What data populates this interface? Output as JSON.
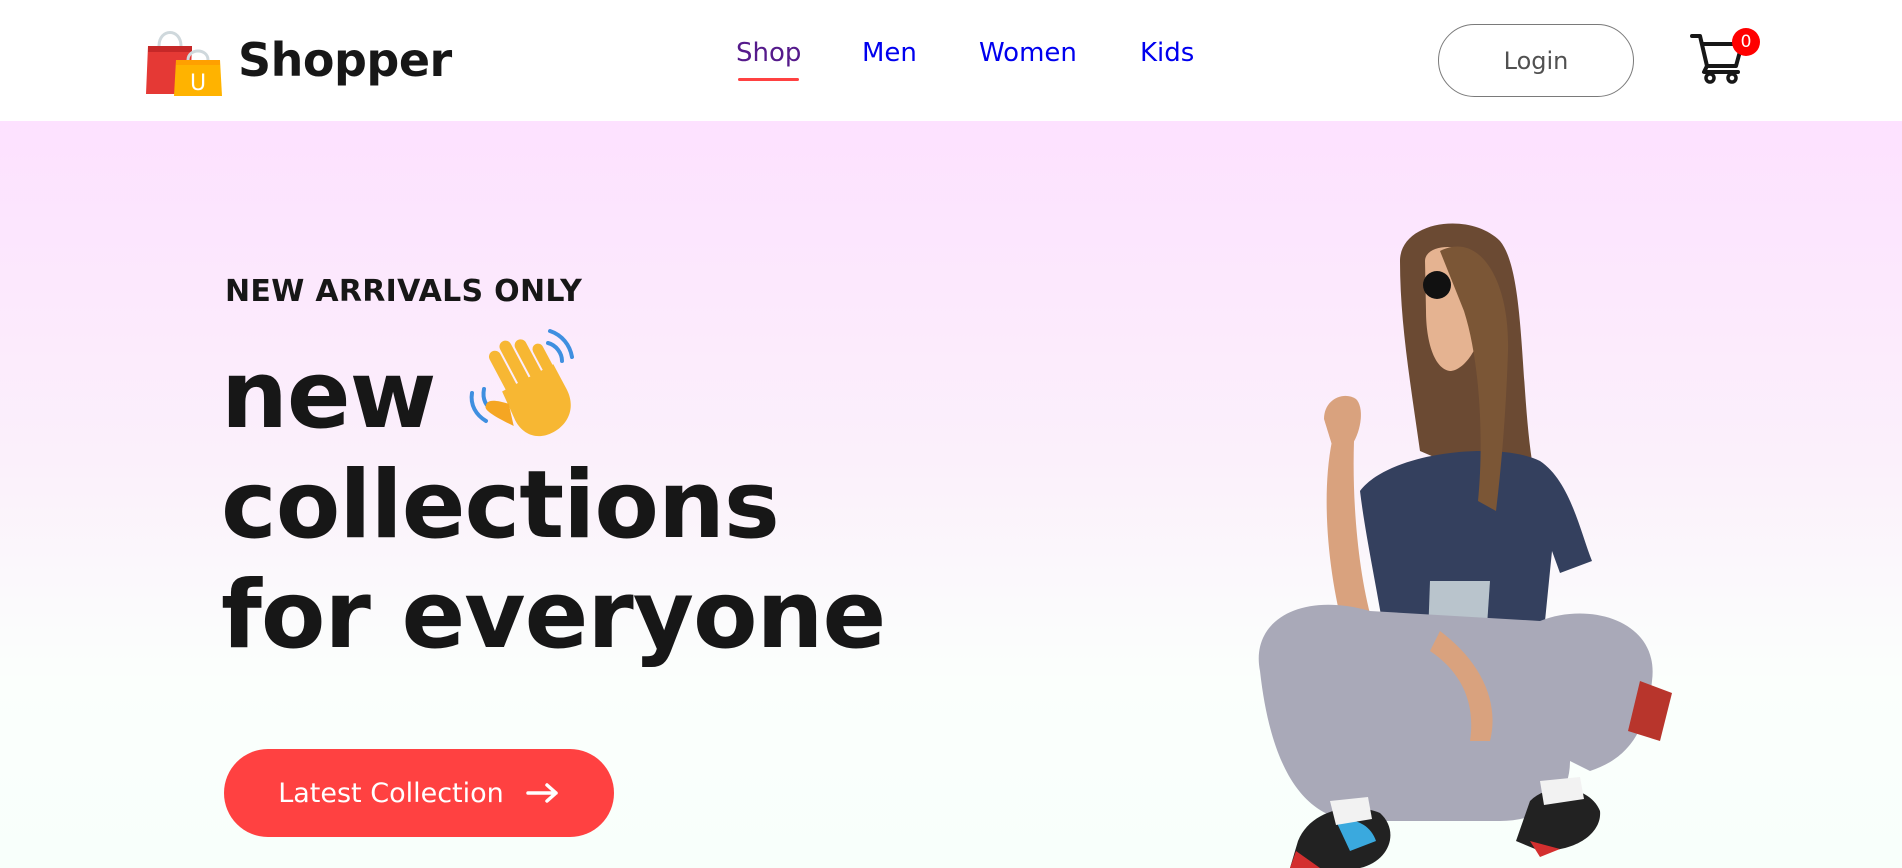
{
  "brand": {
    "name": "Shopper",
    "logo_icon": "shopping-bag-icon",
    "logo_letter": "U"
  },
  "nav": {
    "items": [
      {
        "label": "Shop",
        "active": true
      },
      {
        "label": "Men",
        "active": false
      },
      {
        "label": "Women",
        "active": false
      },
      {
        "label": "Kids",
        "active": false
      }
    ]
  },
  "header": {
    "login_label": "Login",
    "cart_icon": "cart-icon",
    "cart_count": "0"
  },
  "hero": {
    "eyebrow": "NEW ARRIVALS ONLY",
    "headline": [
      "new",
      "collections",
      "for everyone"
    ],
    "headline_icon": "waving-hand-icon",
    "cta_label": "Latest Collection",
    "cta_icon": "arrow-right-icon",
    "image_icon": "model-photo"
  },
  "colors": {
    "accent": "#ff4141",
    "text_dark": "#171717",
    "hero_gradient_top": "#fde1ff",
    "hero_gradient_bottom": "#f8fffb",
    "cart_badge": "#ff0000"
  }
}
